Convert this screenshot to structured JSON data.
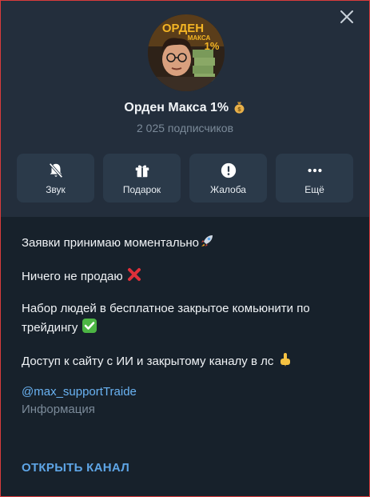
{
  "channel": {
    "name": "Орден Макса 1%",
    "name_emoji_icon": "money-bag-icon",
    "subscribers": "2 025 подписчиков"
  },
  "avatar": {
    "line1": "ОРДЕН",
    "line2": "МАКСА",
    "line3": "1%"
  },
  "actions": [
    {
      "label": "Звук",
      "icon": "bell-off-icon"
    },
    {
      "label": "Подарок",
      "icon": "gift-icon"
    },
    {
      "label": "Жалоба",
      "icon": "report-icon"
    },
    {
      "label": "Ещё",
      "icon": "more-icon"
    }
  ],
  "description": {
    "p1": "Заявки принимаю моментально",
    "p1_emoji": "rocket-icon",
    "p2": "Ничего не продаю ",
    "p2_emoji": "cross-mark-icon",
    "p3": "Набор людей в бесплатное закрытое комьюнити по трейдингу ",
    "p3_emoji": "check-mark-icon",
    "p4": "Доступ к сайту с ИИ и закрытому каналу в лс ",
    "p4_emoji": "pointing-down-icon"
  },
  "info": {
    "mention": "@max_supportTraide",
    "label": "Информация"
  },
  "open_button": "ОТКРЫТЬ КАНАЛ",
  "colors": {
    "accent": "#6ab3f3",
    "panel": "#17212b",
    "header": "#232e3c",
    "button": "#2b3a4a"
  }
}
